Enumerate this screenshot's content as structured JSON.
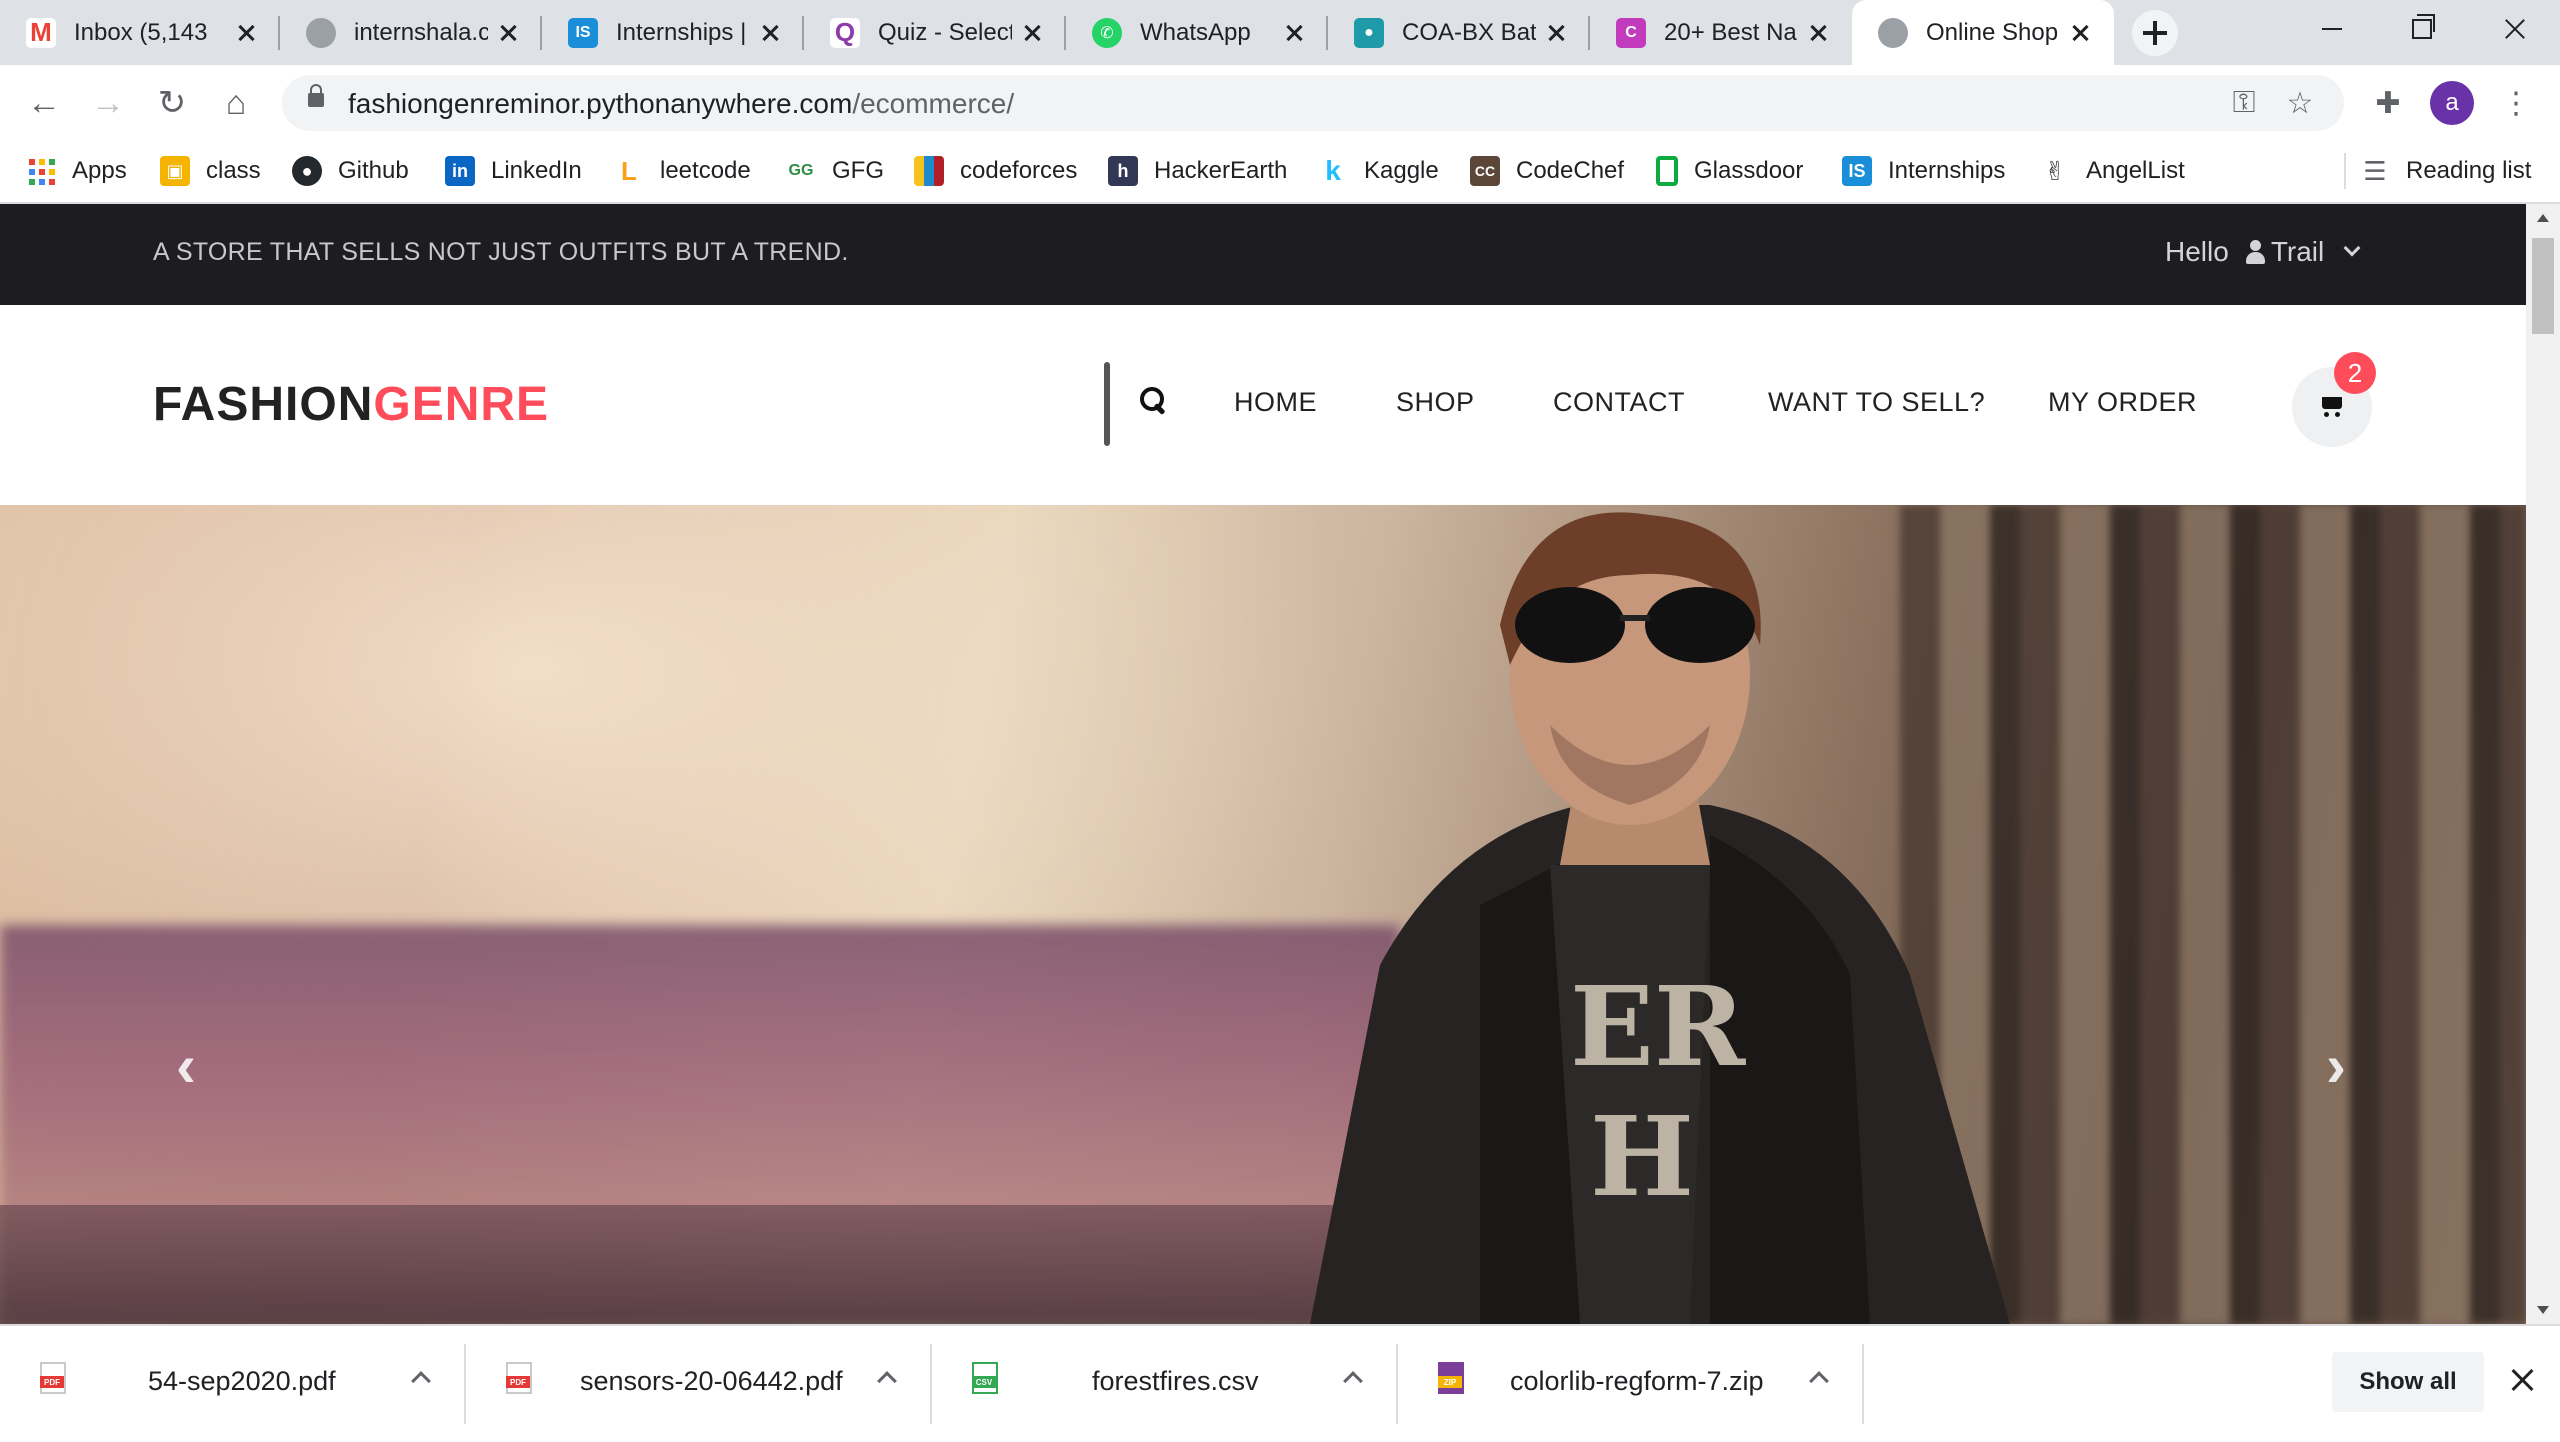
{
  "browser": {
    "tabs": [
      {
        "title": "Inbox (5,143",
        "icon": "gmail-icon",
        "color": "#ea4335",
        "glyph": "M"
      },
      {
        "title": "internshala.c",
        "icon": "globe-icon",
        "color": "#5f6368",
        "glyph": ""
      },
      {
        "title": "Internships |",
        "icon": "internshala-icon",
        "color": "#1a8ed8",
        "glyph": "IS"
      },
      {
        "title": "Quiz - Select",
        "icon": "quiz-icon",
        "color": "#8e3aa8",
        "glyph": "Q"
      },
      {
        "title": "WhatsApp",
        "icon": "whatsapp-icon",
        "color": "#25d366",
        "glyph": ""
      },
      {
        "title": "COA-BX Batc",
        "icon": "classroom-icon",
        "color": "#1e9aa8",
        "glyph": ""
      },
      {
        "title": "20+ Best Na",
        "icon": "site-icon",
        "color": "#c23bbd",
        "glyph": "C"
      },
      {
        "title": "Online Shop",
        "icon": "globe-icon",
        "color": "#5f6368",
        "glyph": "",
        "active": true
      }
    ],
    "url": {
      "host": "fashiongenreminor.pythonanywhere.com",
      "path": "/ecommerce/"
    },
    "profile_initial": "a",
    "bookmarks": [
      {
        "label": "Apps",
        "icon": "apps-grid-icon"
      },
      {
        "label": "class",
        "icon": "classroom-icon",
        "color": "#f4b400",
        "glyph": ""
      },
      {
        "label": "Github",
        "icon": "github-icon",
        "color": "#24292e",
        "glyph": ""
      },
      {
        "label": "LinkedIn",
        "icon": "linkedin-icon",
        "color": "#0a66c2",
        "glyph": "in"
      },
      {
        "label": "leetcode",
        "icon": "leetcode-icon",
        "color": "#f89f1b",
        "glyph": "L"
      },
      {
        "label": "GFG",
        "icon": "gfg-icon",
        "color": "#2f8d46",
        "glyph": "GG"
      },
      {
        "label": "codeforces",
        "icon": "codeforces-icon",
        "color": "#1f8acb",
        "glyph": ""
      },
      {
        "label": "HackerEarth",
        "icon": "hackerearth-icon",
        "color": "#323754",
        "glyph": "h"
      },
      {
        "label": "Kaggle",
        "icon": "kaggle-icon",
        "color": "#20beff",
        "glyph": "k"
      },
      {
        "label": "CodeChef",
        "icon": "codechef-icon",
        "color": "#5b4638",
        "glyph": "CC"
      },
      {
        "label": "Glassdoor",
        "icon": "glassdoor-icon",
        "color": "#0caa41",
        "glyph": ""
      },
      {
        "label": "Internships",
        "icon": "internshala-icon",
        "color": "#1a8ed8",
        "glyph": "IS"
      },
      {
        "label": "AngelList",
        "icon": "angellist-icon",
        "color": "#333333",
        "glyph": "✌"
      }
    ],
    "reading_list": "Reading list"
  },
  "site": {
    "tagline": "A STORE THAT SELLS NOT JUST OUTFITS BUT A TREND.",
    "greeting": "Hello",
    "username": "Trail",
    "logo_main": "FASHION",
    "logo_accent": "GENRE",
    "nav": [
      "HOME",
      "SHOP",
      "CONTACT",
      "WANT TO SELL?",
      "MY ORDER"
    ],
    "cart_count": "2",
    "accent_color": "#ff4c5b",
    "carousel": {
      "prev": "‹",
      "next": "›"
    }
  },
  "downloads": {
    "files": [
      {
        "name": "54-sep2020.pdf",
        "type": "PDF"
      },
      {
        "name": "sensors-20-06442.pdf",
        "type": "PDF"
      },
      {
        "name": "forestfires.csv",
        "type": "CSV"
      },
      {
        "name": "colorlib-regform-7.zip",
        "type": "ZIP"
      }
    ],
    "show_all": "Show all"
  }
}
